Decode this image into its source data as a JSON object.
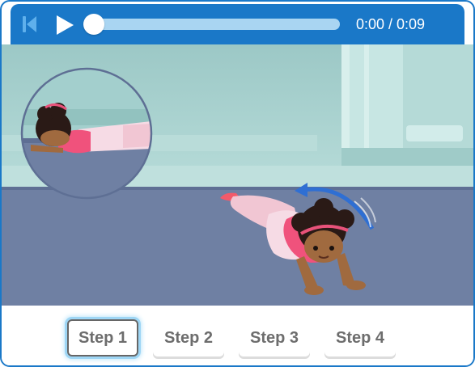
{
  "player": {
    "time_text": "0:00 / 0:09",
    "progress": 0,
    "icons": {
      "skip": "skip-back-icon",
      "play": "play-icon"
    }
  },
  "steps": [
    {
      "label": "Step 1",
      "active": true
    },
    {
      "label": "Step 2",
      "active": false
    },
    {
      "label": "Step 3",
      "active": false
    },
    {
      "label": "Step 4",
      "active": false
    }
  ],
  "colors": {
    "accent": "#1a78c8",
    "seek_track": "#a9d5f2",
    "floor": "#6f80a3",
    "wall": "#a8d1cf",
    "shirt": "#f0527c",
    "arrow": "#2f6fd3"
  }
}
